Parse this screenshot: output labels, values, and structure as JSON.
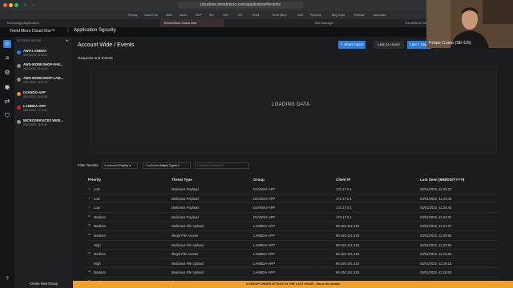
{
  "browser": {
    "url": "cloudone.trendmicro.com/application#/events",
    "bookmarks": [
      "Privacy",
      "Cloud One",
      "AWS",
      "Azure",
      "GCP",
      "Sec",
      "Vuln",
      "IOT",
      "Kiosk",
      "Trend Micro",
      "CDS",
      "Personal",
      "Blog Tools",
      "Podcast",
      "Accenture"
    ],
    "tabs": [
      "Technology Application",
      "Trend Micro Cloud One",
      "Test Manager",
      "TrendMicro Cloud One"
    ]
  },
  "app": {
    "product": "Trend Micro Cloud One™",
    "section": "Application Security"
  },
  "groups": {
    "header": "FILTER BY GROUP",
    "items": [
      {
        "name": "AWS-LAMBDA",
        "sub": "03/01/2022, 16:38:32",
        "color": "#2a7de1"
      },
      {
        "name": "AWS-WORKSHOP-FAR...",
        "sub": "03/01/2022, 16:02:33",
        "color": "#8a8d92"
      },
      {
        "name": "AWS-WORKSHOP-LAM...",
        "sub": "03/01/2022, 16:07:18",
        "color": "#8a8d92"
      },
      {
        "name": "DJANGO-APP",
        "sub": "03/01/2022, 16:02:58",
        "color": "#f08c1a"
      },
      {
        "name": "LAMBDA-APP",
        "sub": "03/01/2022, 17:12:30",
        "color": "#d71920"
      },
      {
        "name": "MICROSERVICES WEB...",
        "sub": "03/01/2022, 16:39:47",
        "color": "#8a8d92"
      }
    ],
    "create_label": "Create New Group"
  },
  "main": {
    "title": "Account Wide / Events",
    "share_label": "Share report",
    "range_24h": "Last 24 Hours",
    "range_7d": "Last 7 Days",
    "chart_heading": "Requests and Events",
    "loading": "LOADING DATA",
    "filter_label": "Filter Results",
    "priority_selected": "4 selected",
    "priority_label": "Priority",
    "threat_selected": "7 selected",
    "threat_label": "Attack Types",
    "search_placeholder": "Search Source IP"
  },
  "table": {
    "columns": [
      "Priority",
      "Threat Type",
      "Group",
      "Client IP",
      "Last Seen (MM/DD/YYYY)"
    ],
    "rows": [
      {
        "priority": "Low",
        "threat": "Malicious Payload",
        "group": "DJANGO-APP",
        "ip": "172.17.0.1",
        "seen": "03/01/2022, 11:25:23"
      },
      {
        "priority": "Low",
        "threat": "Malicious Payload",
        "group": "DJANGO-APP",
        "ip": "172.17.0.1",
        "seen": "03/01/2022, 11:24:45"
      },
      {
        "priority": "Low",
        "threat": "Malicious Payload",
        "group": "DJANGO-APP",
        "ip": "172.17.0.1",
        "seen": "03/01/2022, 11:24:44"
      },
      {
        "priority": "Medium",
        "threat": "Malicious Payload",
        "group": "DJANGO-APP",
        "ip": "172.17.0.1",
        "seen": "03/01/2022, 11:24:31"
      },
      {
        "priority": "Medium",
        "threat": "Malicious File Upload",
        "group": "LAMBDA-APP",
        "ip": "99.150.101.223",
        "seen": "03/01/2022, 11:21:07"
      },
      {
        "priority": "Medium",
        "threat": "Illegal File Access",
        "group": "LAMBDA-APP",
        "ip": "99.150.101.223",
        "seen": "03/01/2022, 11:20:59"
      },
      {
        "priority": "High",
        "threat": "Malicious File Upload",
        "group": "LAMBDA-APP",
        "ip": "99.150.101.223",
        "seen": "03/01/2022, 11:20:58"
      },
      {
        "priority": "Medium",
        "threat": "Illegal File Access",
        "group": "LAMBDA-APP",
        "ip": "99.150.101.223",
        "seen": "03/01/2022, 11:19:56"
      },
      {
        "priority": "High",
        "threat": "Malicious File Upload",
        "group": "LAMBDA-APP",
        "ip": "99.150.101.223",
        "seen": "03/01/2022, 11:19:18"
      },
      {
        "priority": "Medium",
        "threat": "Malicious File Upload",
        "group": "LAMBDA-APP",
        "ip": "99.150.101.223",
        "seen": "03/01/2022, 11:18:53"
      },
      {
        "priority": "Medium",
        "threat": "Illegal File Access",
        "group": "LAMBDA-APP",
        "ip": "99.150.101.223",
        "seen": "03/01/2022, 11:18:08"
      }
    ]
  },
  "priority_colors": {
    "Low": "#f08c1a",
    "Medium": "#9aa0a6",
    "High": "#d71920"
  },
  "banner": "3 GROUP UNDER ATTACK IN THE LAST HOUR - Show the details",
  "webcam": {
    "name": "Felipe Costa (SE-US)"
  }
}
